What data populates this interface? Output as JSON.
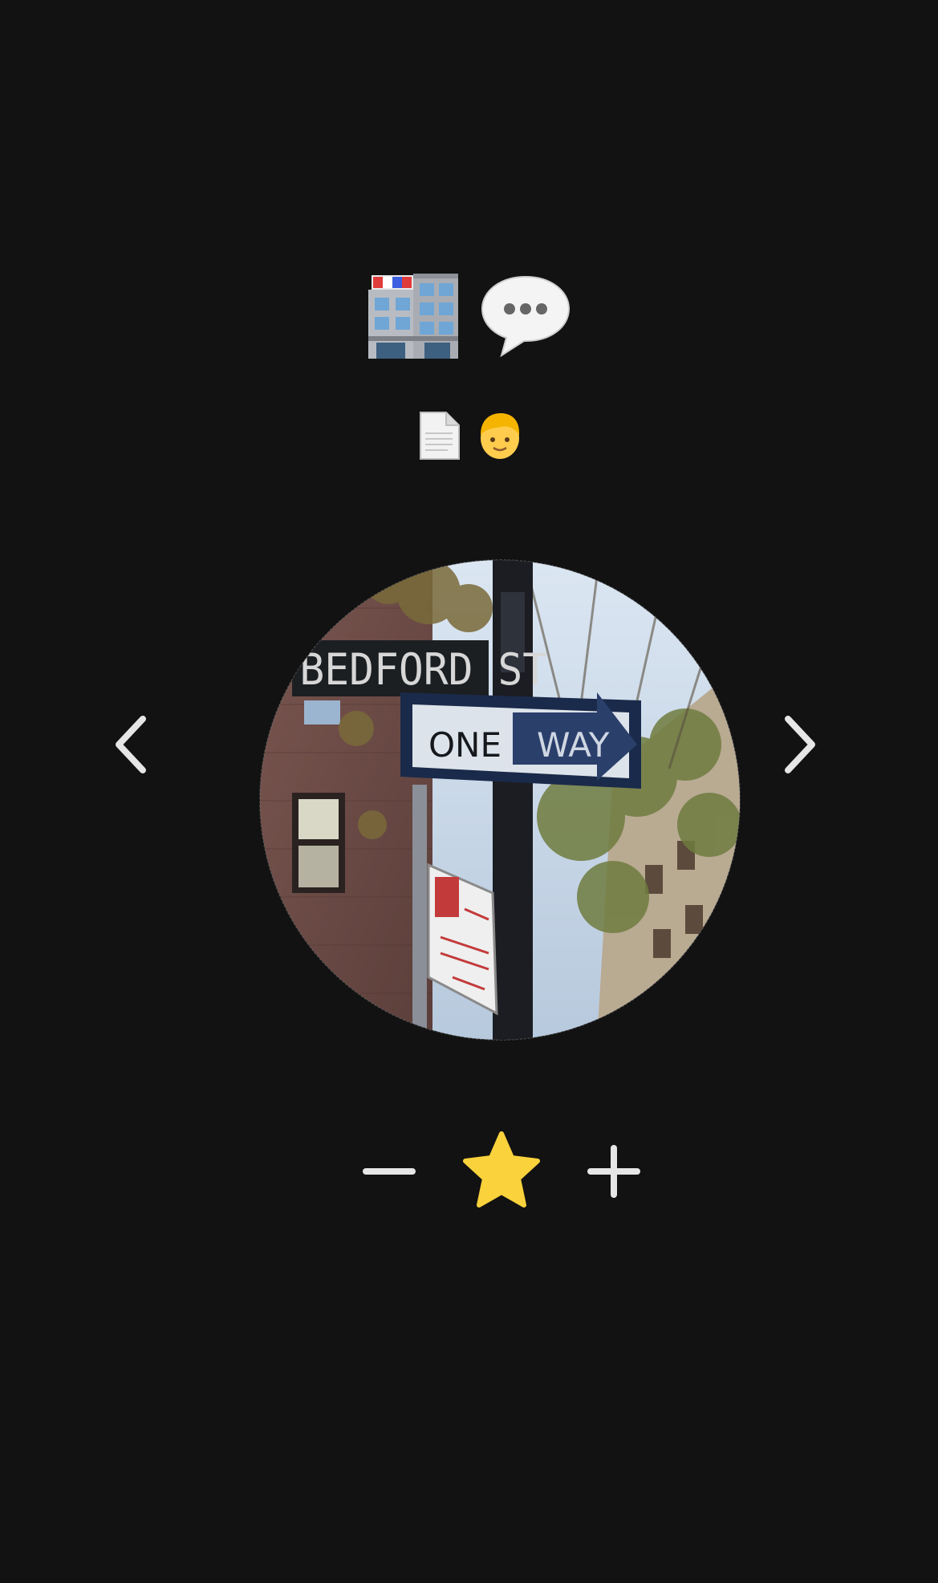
{
  "header": {
    "row1_icons": [
      "department-store-icon",
      "speech-bubble-icon"
    ],
    "row2_icons": [
      "document-icon",
      "person-icon"
    ]
  },
  "photo": {
    "sign_street": "BEDFORD ST",
    "sign_oneway_left": "ONE",
    "sign_oneway_right": "WAY"
  },
  "navigation": {
    "prev_icon": "chevron-left-icon",
    "next_icon": "chevron-right-icon"
  },
  "controls": {
    "minus_icon": "minus-icon",
    "star_icon": "star-icon",
    "plus_icon": "plus-icon"
  },
  "colors": {
    "background": "#121212",
    "icon_light": "#e6e6e6",
    "star": "#f9d23c"
  }
}
